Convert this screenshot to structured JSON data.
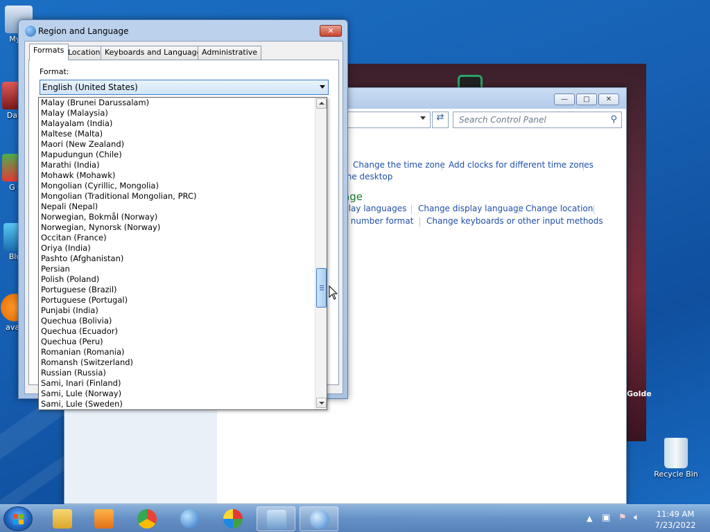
{
  "desktop": {
    "icons": [
      {
        "label": "My C",
        "name": "my-computer"
      },
      {
        "label": "Data",
        "name": "data"
      },
      {
        "label": "G C",
        "name": "g-c"
      },
      {
        "label": "Blue",
        "name": "blue"
      },
      {
        "label": "avas",
        "name": "avast"
      },
      {
        "label": "Recycle Bin",
        "name": "recycle-bin"
      }
    ],
    "bg_text": "Golde"
  },
  "control_panel": {
    "search_placeholder": "Search Control Panel",
    "links_row1": [
      "Change the time zone",
      "Add clocks for different time zones"
    ],
    "link_desktop": "the desktop",
    "section_title_fragment": "age",
    "links_row2": [
      "play languages",
      "Change display language",
      "Change location"
    ],
    "links_row3": [
      "r number format",
      "Change keyboards or other input methods"
    ]
  },
  "dialog": {
    "title": "Region and Language",
    "close_label": "✕",
    "tabs": [
      "Formats",
      "Location",
      "Keyboards and Languages",
      "Administrative"
    ],
    "active_tab": "Formats",
    "format_label": "Format:",
    "format_value": "English (United States)",
    "dropdown_items": [
      "Malay (Brunei Darussalam)",
      "Malay (Malaysia)",
      "Malayalam (India)",
      "Maltese (Malta)",
      "Maori (New Zealand)",
      "Mapudungun (Chile)",
      "Marathi (India)",
      "Mohawk (Mohawk)",
      "Mongolian (Cyrillic, Mongolia)",
      "Mongolian (Traditional Mongolian, PRC)",
      "Nepali (Nepal)",
      "Norwegian, Bokmål (Norway)",
      "Norwegian, Nynorsk (Norway)",
      "Occitan (France)",
      "Oriya (India)",
      "Pashto (Afghanistan)",
      "Persian",
      "Polish (Poland)",
      "Portuguese (Brazil)",
      "Portuguese (Portugal)",
      "Punjabi (India)",
      "Quechua (Bolivia)",
      "Quechua (Ecuador)",
      "Quechua (Peru)",
      "Romanian (Romania)",
      "Romansh (Switzerland)",
      "Russian (Russia)",
      "Sami, Inari (Finland)",
      "Sami, Lule (Norway)",
      "Sami, Lule (Sweden)"
    ]
  },
  "taskbar": {
    "apps": [
      "windows-explorer",
      "media-player",
      "chrome",
      "network-globe",
      "color-app",
      "control-panel",
      "region-language"
    ],
    "active_apps": [
      "control-panel",
      "region-language"
    ],
    "time": "11:49 AM",
    "date": "7/23/2022"
  },
  "colors": {
    "accent": "#3d7bc7",
    "link": "#1e4fa8",
    "section_green": "#1b7a2b"
  }
}
